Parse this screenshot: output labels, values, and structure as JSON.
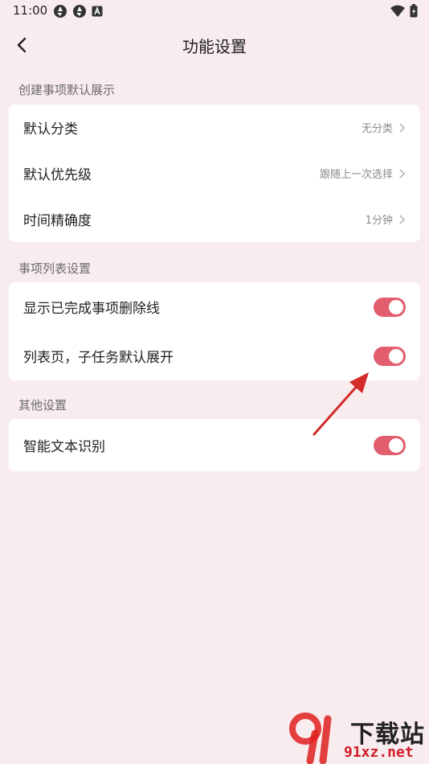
{
  "status_bar": {
    "time": "11:00"
  },
  "header": {
    "title": "功能设置"
  },
  "sections": [
    {
      "label": "创建事项默认展示",
      "rows": [
        {
          "label": "默认分类",
          "value": "无分类"
        },
        {
          "label": "默认优先级",
          "value": "跟随上一次选择"
        },
        {
          "label": "时间精确度",
          "value": "1分钟"
        }
      ]
    },
    {
      "label": "事项列表设置",
      "rows": [
        {
          "label": "显示已完成事项删除线",
          "toggle": true
        },
        {
          "label": "列表页，子任务默认展开",
          "toggle": true
        }
      ]
    },
    {
      "label": "其他设置",
      "rows": [
        {
          "label": "智能文本识别",
          "toggle": true
        }
      ]
    }
  ],
  "watermark": {
    "title": "下载站",
    "site": "91xz.net"
  },
  "colors": {
    "accent": "#e25d6e",
    "background": "#f8ecee",
    "arrow": "#d42a2a"
  }
}
